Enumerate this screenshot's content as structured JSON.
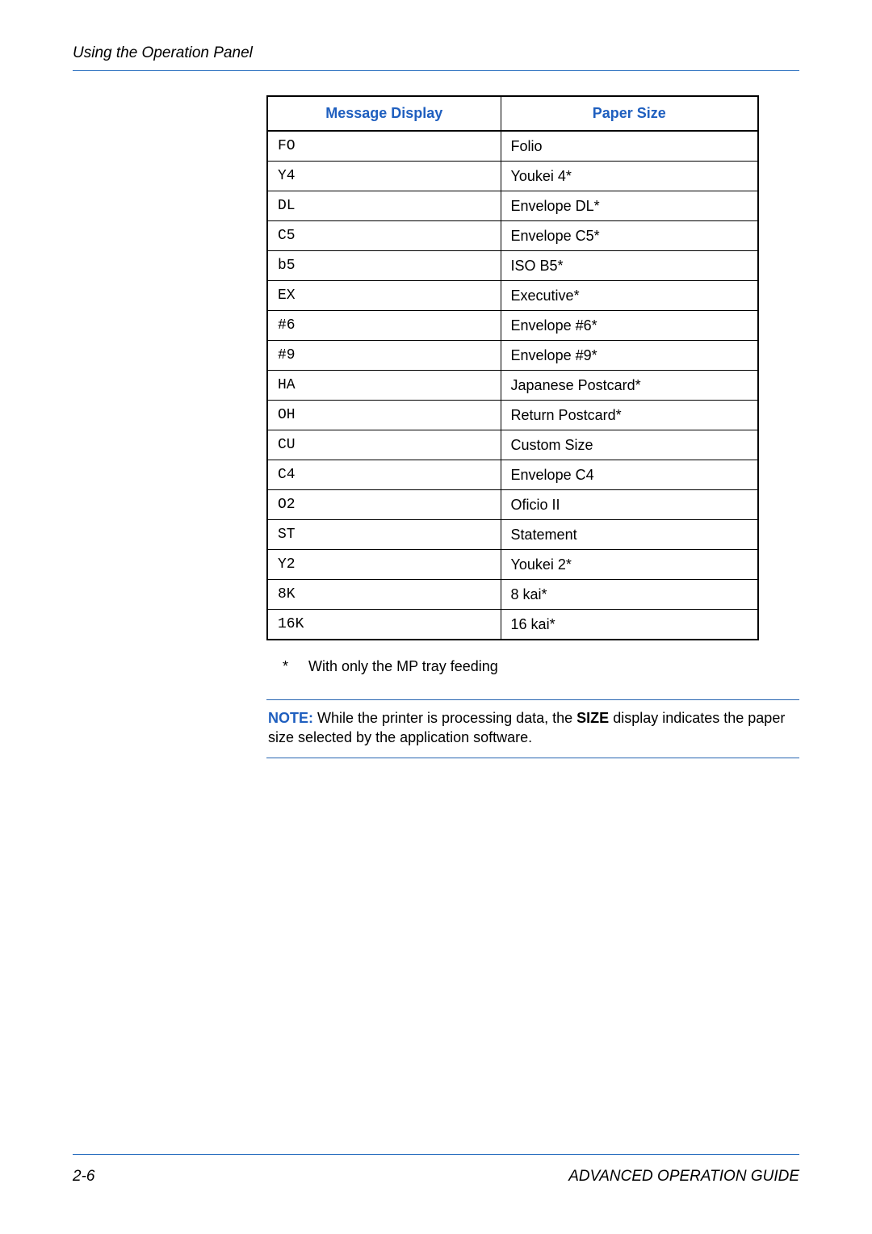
{
  "header": {
    "section_title": "Using the Operation Panel"
  },
  "table": {
    "headers": {
      "col1": "Message Display",
      "col2": "Paper Size"
    },
    "rows": [
      {
        "code": "FO",
        "size": "Folio"
      },
      {
        "code": "Y4",
        "size": "Youkei 4*"
      },
      {
        "code": "DL",
        "size": "Envelope DL*"
      },
      {
        "code": "C5",
        "size": "Envelope C5*"
      },
      {
        "code": "b5",
        "size": "ISO B5*"
      },
      {
        "code": "EX",
        "size": "Executive*"
      },
      {
        "code": "#6",
        "size": "Envelope #6*"
      },
      {
        "code": "#9",
        "size": "Envelope #9*"
      },
      {
        "code": "HA",
        "size": "Japanese Postcard*"
      },
      {
        "code": "OH",
        "size": "Return Postcard*"
      },
      {
        "code": "CU",
        "size": "Custom Size"
      },
      {
        "code": "C4",
        "size": "Envelope C4"
      },
      {
        "code": "O2",
        "size": "Oficio II"
      },
      {
        "code": "ST",
        "size": "Statement"
      },
      {
        "code": "Y2",
        "size": "Youkei 2*"
      },
      {
        "code": "8K",
        "size": "8 kai*"
      },
      {
        "code": "16K",
        "size": "16 kai*"
      }
    ]
  },
  "footnote": {
    "marker": "*",
    "text": "With only the MP tray feeding"
  },
  "note": {
    "label": "NOTE:",
    "before": " While the printer is processing data, the ",
    "size_word": "SIZE",
    "after": " display indicates the paper size selected by the application software."
  },
  "footer": {
    "page_number": "2-6",
    "guide_title": "ADVANCED OPERATION GUIDE"
  }
}
